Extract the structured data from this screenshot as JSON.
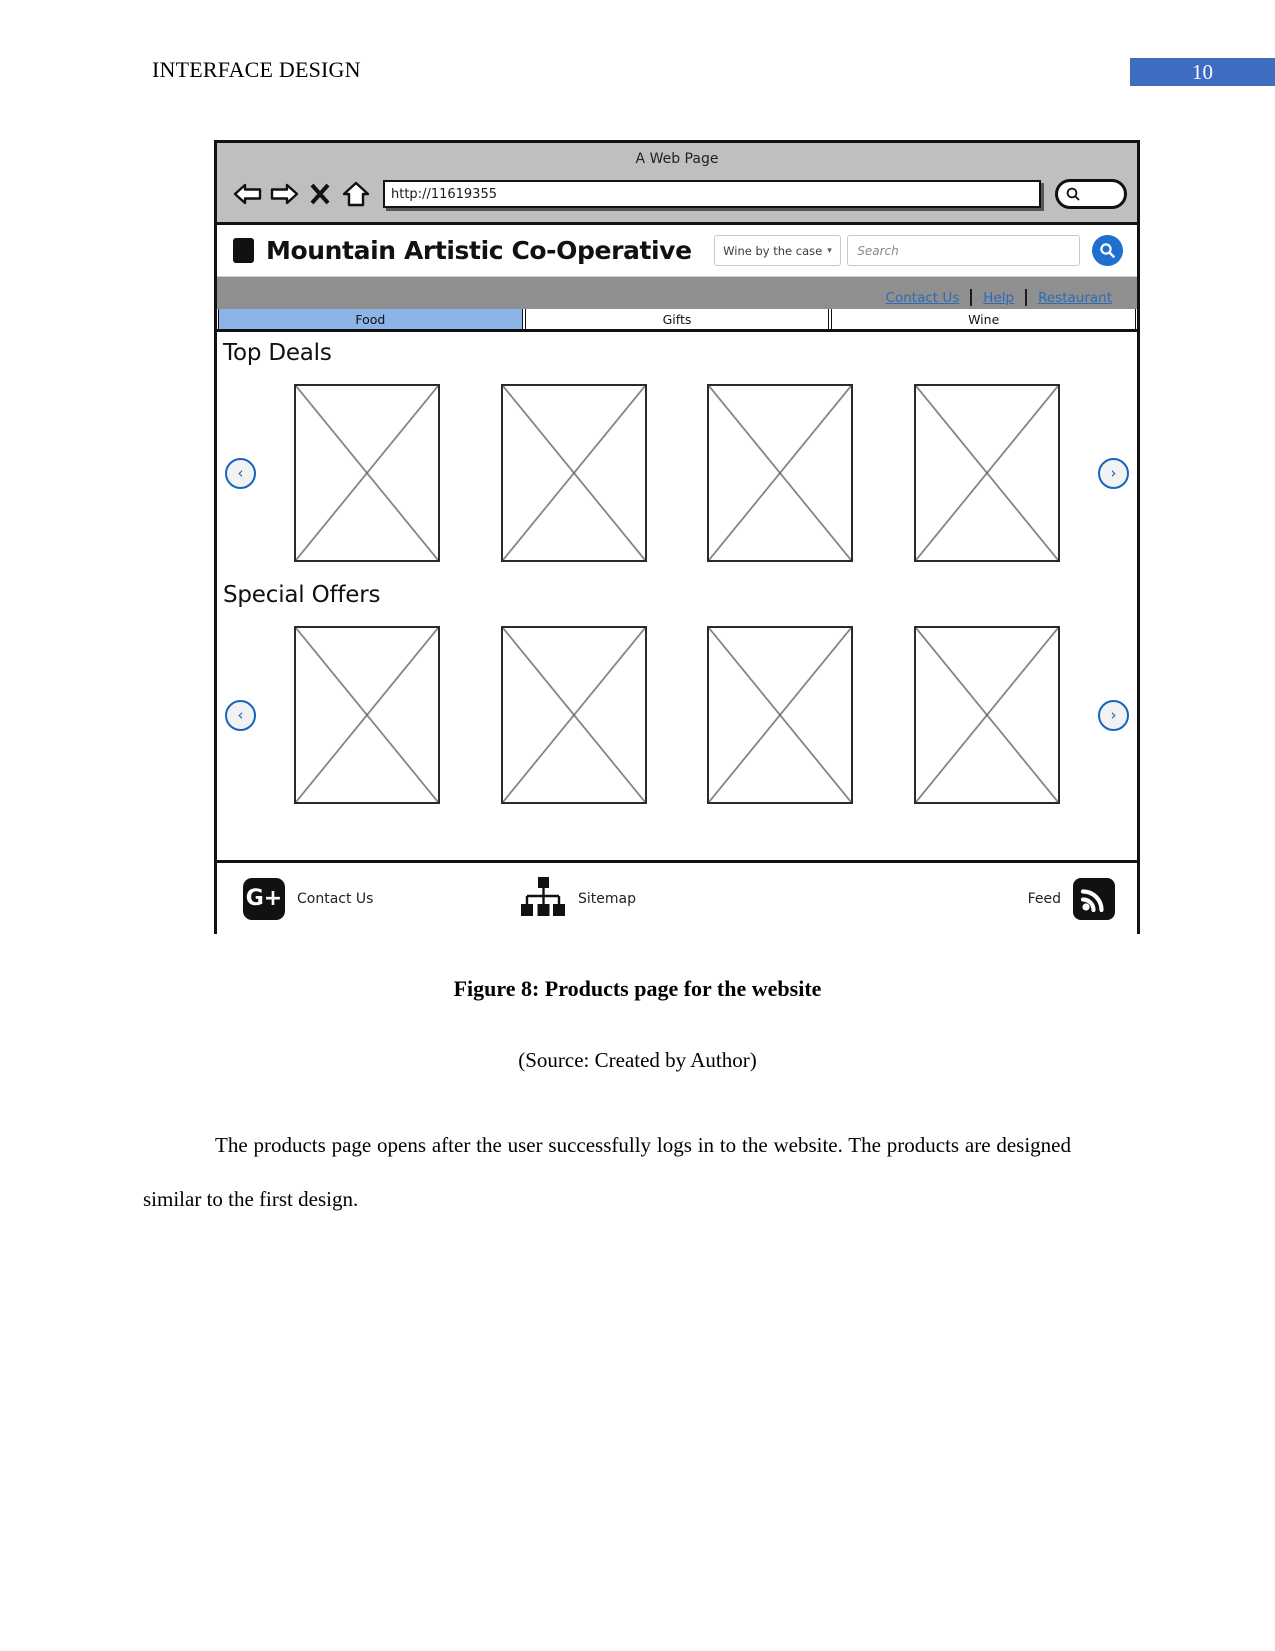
{
  "document": {
    "running_head": "INTERFACE DESIGN",
    "page_number": "10",
    "figure_caption": "Figure 8: Products page for the website",
    "figure_source": "(Source: Created by Author)",
    "body_paragraph": "The products page opens after the user successfully logs in to the website. The products are designed similar to the first design."
  },
  "wireframe": {
    "browser": {
      "title": "A Web Page",
      "url": "http://11619355",
      "back_label": "Back",
      "forward_label": "Forward",
      "stop_label": "Stop",
      "home_label": "Home",
      "search_label": "Search"
    },
    "site_header": {
      "brand": "Mountain Artistic Co-Operative",
      "category_select": "Wine by the case",
      "search_placeholder": "Search",
      "search_button_label": "Search"
    },
    "utility_links": [
      {
        "label": "Contact Us"
      },
      {
        "label": "Help"
      },
      {
        "label": "Restaurant"
      }
    ],
    "tabs": [
      {
        "label": "Food",
        "active": true
      },
      {
        "label": "Gifts",
        "active": false
      },
      {
        "label": "Wine",
        "active": false
      }
    ],
    "sections": [
      {
        "title": "Top Deals",
        "prev_label": "‹",
        "next_label": "›",
        "items": [
          {
            "alt": "product-placeholder-1"
          },
          {
            "alt": "product-placeholder-2"
          },
          {
            "alt": "product-placeholder-3"
          },
          {
            "alt": "product-placeholder-4"
          }
        ]
      },
      {
        "title": "Special Offers",
        "prev_label": "‹",
        "next_label": "›",
        "items": [
          {
            "alt": "offer-placeholder-1"
          },
          {
            "alt": "offer-placeholder-2"
          },
          {
            "alt": "offer-placeholder-3"
          },
          {
            "alt": "offer-placeholder-4"
          }
        ]
      }
    ],
    "footer": {
      "contact_label": "Contact Us",
      "sitemap_label": "Sitemap",
      "feed_label": "Feed",
      "gplus_glyph": "G+"
    }
  },
  "colors": {
    "accent_blue": "#3d6cc0",
    "tab_active": "#8db4e8",
    "link_blue": "#2b6cb8",
    "search_blue": "#1f6fd0",
    "chrome_gray": "#bfbfbf",
    "util_gray": "#8f8f8f"
  }
}
